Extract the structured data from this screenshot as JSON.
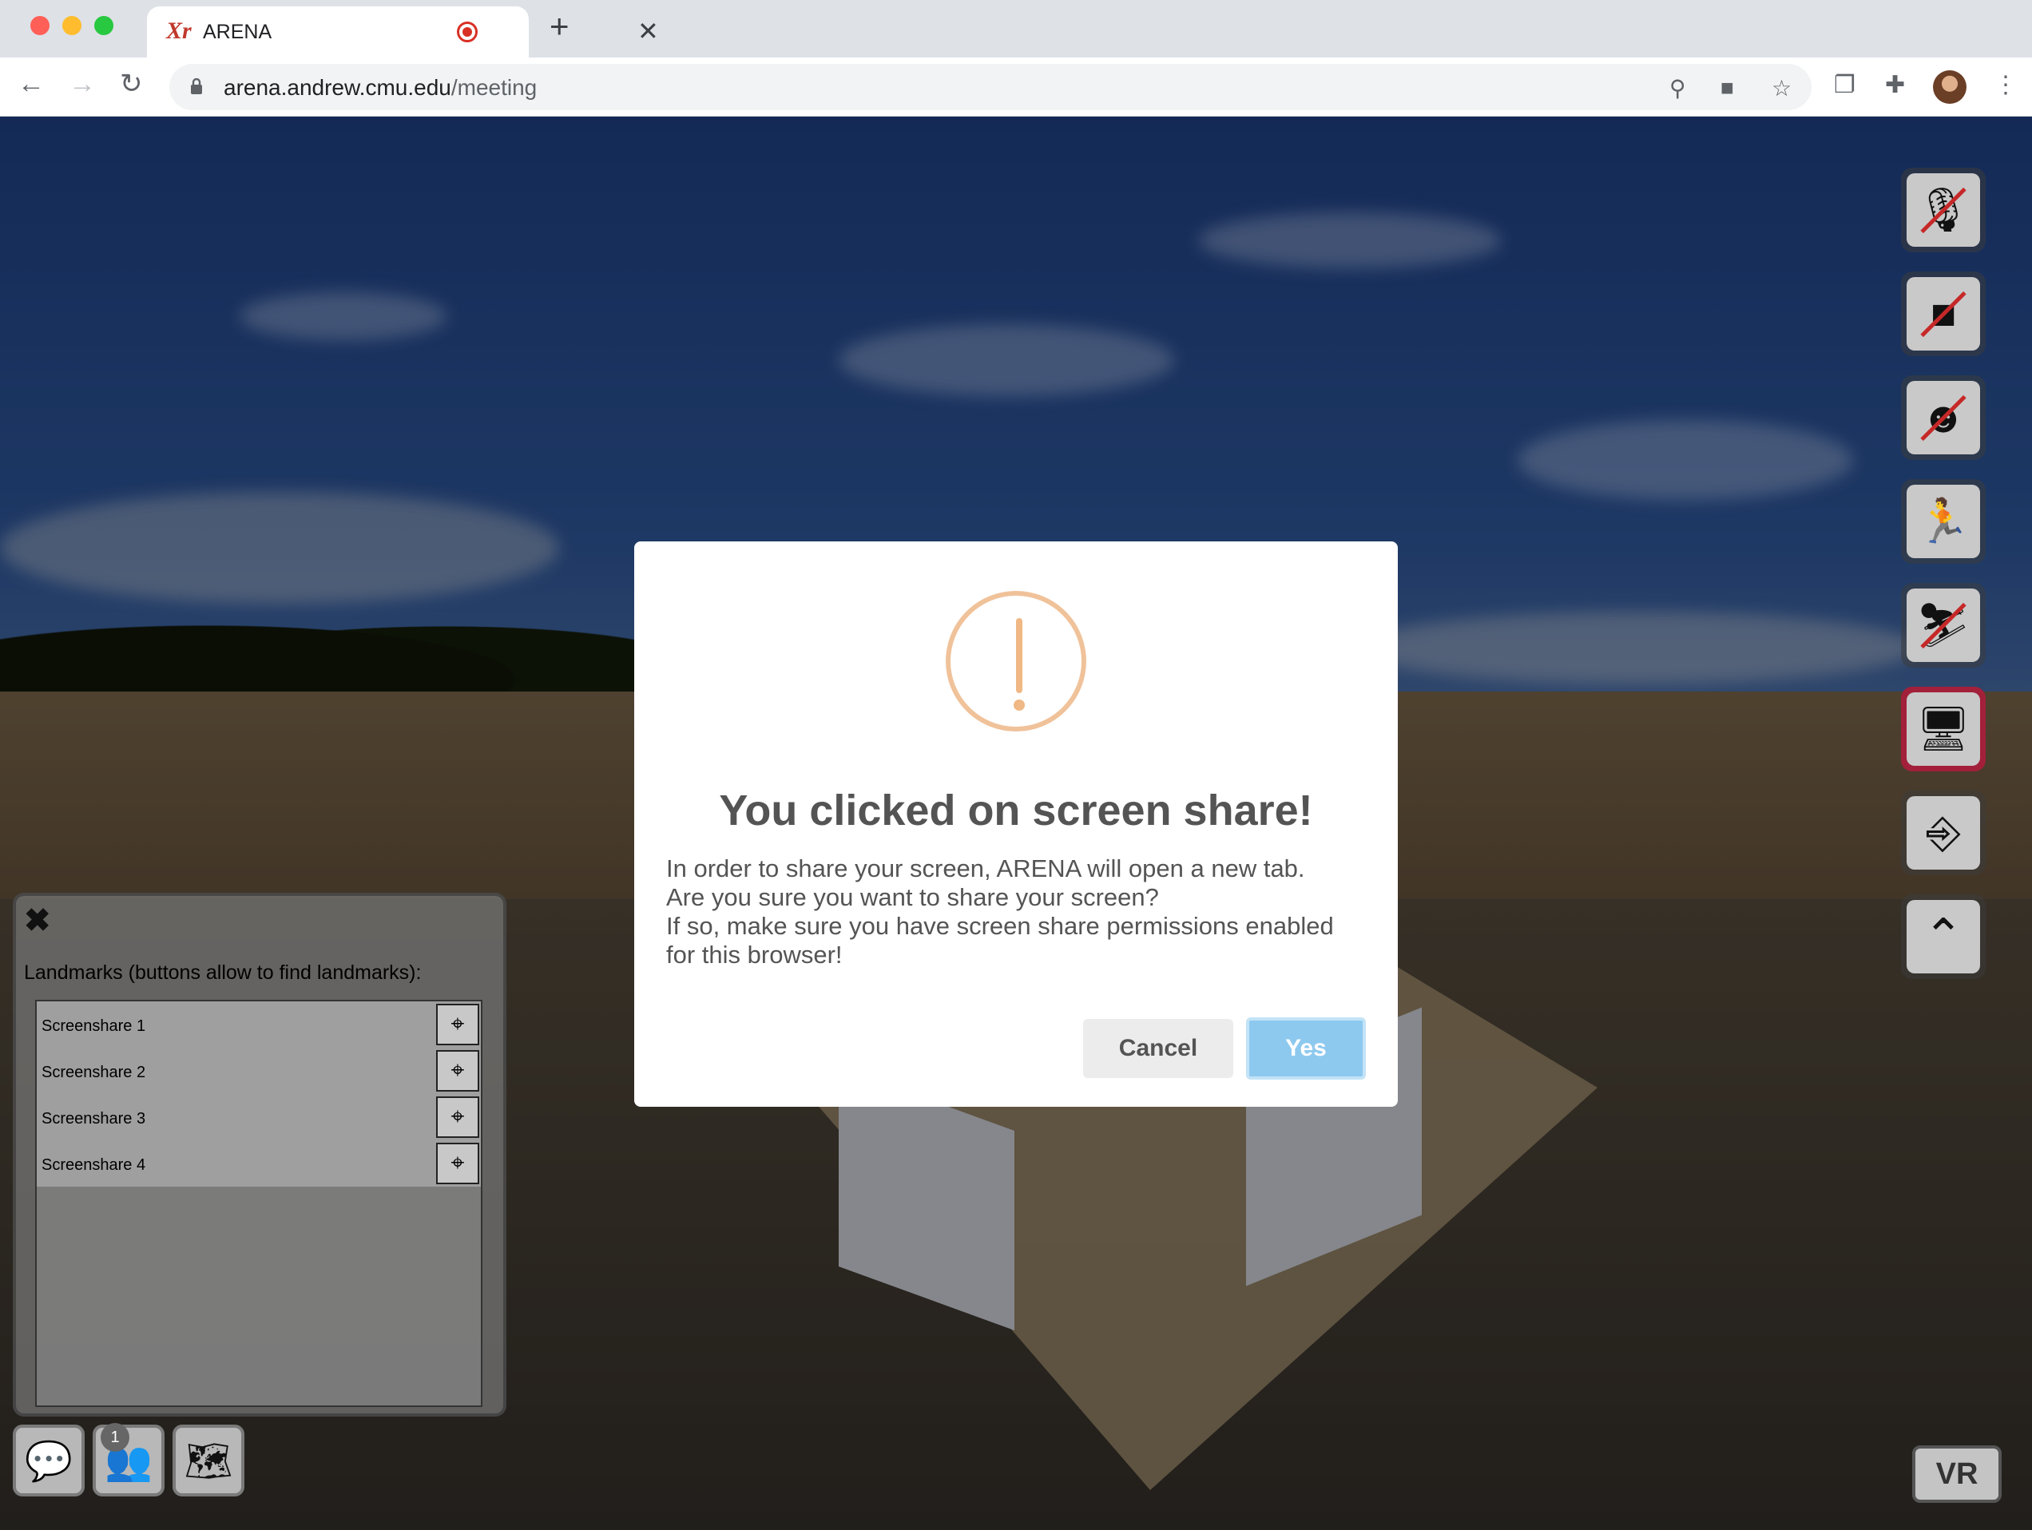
{
  "browser": {
    "tab_title": "ARENA",
    "tab_favicon": "Xr",
    "url_host": "arena.andrew.cmu.edu",
    "url_path": "/meeting"
  },
  "side_controls": [
    {
      "name": "mic-off",
      "icon": "microphone-muted-icon"
    },
    {
      "name": "camera-off",
      "icon": "video-off-icon"
    },
    {
      "name": "face-tracking-off",
      "icon": "face-tracking-off-icon"
    },
    {
      "name": "speed",
      "icon": "running-figure-icon"
    },
    {
      "name": "fly-off",
      "icon": "flying-figure-off-icon"
    },
    {
      "name": "screen-share",
      "icon": "monitor-icon",
      "active": true
    },
    {
      "name": "logout",
      "icon": "exit-door-icon"
    },
    {
      "name": "collapse",
      "icon": "chevron-up-icon"
    }
  ],
  "landmarks": {
    "title": "Landmarks (buttons allow to find landmarks):",
    "items": [
      "Screenshare 1",
      "Screenshare 2",
      "Screenshare 3",
      "Screenshare 4"
    ]
  },
  "bottom_left": {
    "users_badge": "1"
  },
  "vr_label": "VR",
  "modal": {
    "title": "You clicked on screen share!",
    "lines": [
      "In order to share your screen, ARENA will open a new tab.",
      "Are you sure you want to share your screen?",
      "If so, make sure you have screen share permissions enabled",
      "for this browser!"
    ],
    "cancel_label": "Cancel",
    "confirm_label": "Yes"
  },
  "colors": {
    "accent_active": "#a2203a",
    "confirm_button": "#8dc9ef",
    "warning_icon": "#f0c29a"
  }
}
